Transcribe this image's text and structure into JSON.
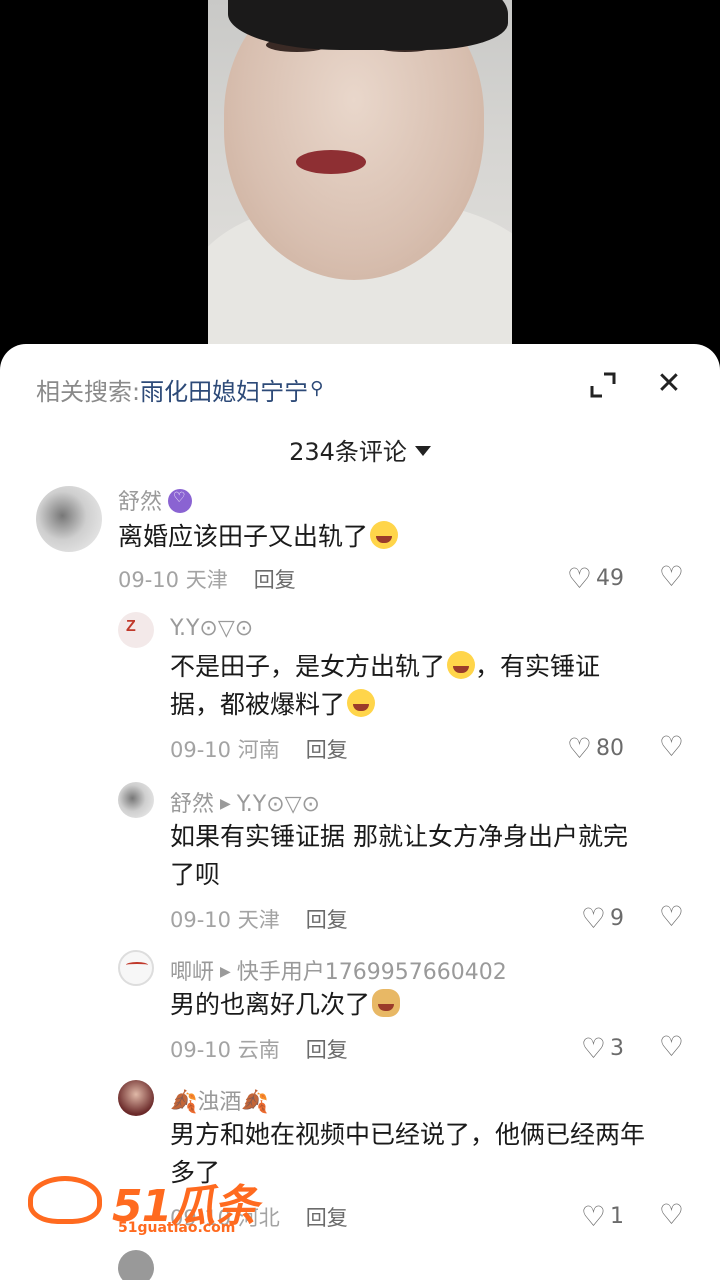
{
  "related_search": {
    "prefix": "相关搜索:",
    "query": "雨化田媳妇宁宁",
    "icon": "search-icon"
  },
  "header": {
    "comment_count": "234条评论",
    "expand_icon": "expand-icon",
    "close_icon": "close-icon",
    "close_glyph": "✕"
  },
  "comments": [
    {
      "user": "舒然",
      "text": "离婚应该田子又出轨了",
      "date": "09-10",
      "location": "天津",
      "reply_label": "回复",
      "likes": "49",
      "level": "top"
    },
    {
      "user": "Y.Y⊙▽⊙",
      "text_line1": "不是田子，是女方出轨了",
      "text_line1b": "，有实锤证",
      "text_line2": "据，都被爆料了",
      "date": "09-10",
      "location": "河南",
      "reply_label": "回复",
      "likes": "80",
      "level": "reply"
    },
    {
      "user": "舒然",
      "reply_to": "Y.Y⊙▽⊙",
      "text_line1": "如果有实锤证据  那就让女方净身出户就完",
      "text_line2": "了呗",
      "date": "09-10",
      "location": "天津",
      "reply_label": "回复",
      "likes": "9",
      "level": "reply"
    },
    {
      "user": "唧岍",
      "reply_to": "快手用户1769957660402",
      "text": "男的也离好几次了",
      "date": "09-10",
      "location": "云南",
      "reply_label": "回复",
      "likes": "3",
      "level": "reply"
    },
    {
      "user": "浊酒",
      "text_line1": "男方和她在视频中已经说了，他俩已经两年",
      "text_line2": "多了",
      "date": "09-10",
      "location": "河北",
      "reply_label": "回复",
      "likes": "1",
      "level": "reply"
    }
  ],
  "watermark": {
    "brand": "51瓜条",
    "url": "51guatiao.com"
  },
  "colors": {
    "link": "#2d4a78",
    "badge": "#8a63d2",
    "watermark": "#ff6a1f"
  }
}
